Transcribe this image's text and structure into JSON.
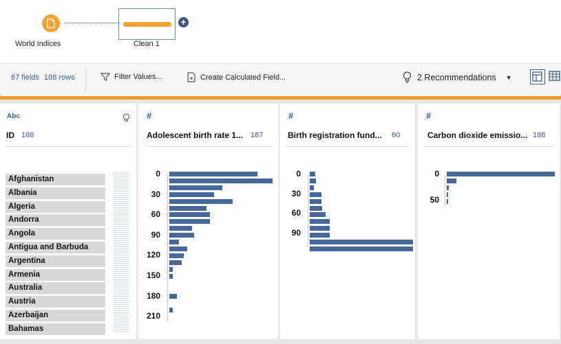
{
  "flow": {
    "input_node_label": "World Indices",
    "clean_node_label": "Clean 1",
    "add_step_symbol": "+"
  },
  "toolbar": {
    "fields_label": "67 fields",
    "rows_label": "188 rows",
    "filter_label": "Filter Values...",
    "calc_label": "Create Calculated Field...",
    "recommendations_label": "2 Recommendations",
    "caret": "▼"
  },
  "colors": {
    "accent": "#f0a334",
    "bar": "#45679a",
    "link": "#3e5b85"
  },
  "fields": {
    "id": {
      "type": "Abc",
      "name": "ID",
      "count": "188",
      "values": [
        "Afghanistan",
        "Albania",
        "Algeria",
        "Andorra",
        "Angola",
        "Antigua and Barbuda",
        "Argentina",
        "Armenia",
        "Australia",
        "Austria",
        "Azerbaijan",
        "Bahamas"
      ]
    },
    "adolescent": {
      "type": "#",
      "name": "Adolescent birth rate 1...",
      "count": "187",
      "ticks": [
        "0",
        "30",
        "60",
        "90",
        "120",
        "150",
        "180",
        "210"
      ],
      "bins": [
        0.85,
        1.0,
        0.51,
        0.43,
        0.61,
        0.36,
        0.39,
        0.39,
        0.22,
        0.24,
        0.09,
        0.17,
        0.14,
        0.12,
        0.03,
        0.03,
        0,
        0,
        0.07,
        0,
        0.03
      ]
    },
    "birth_reg": {
      "type": "#",
      "name": "Birth registration fund...",
      "count": "60",
      "ticks": [
        "0",
        "30",
        "60",
        "90"
      ],
      "bins": [
        0.05,
        0.06,
        0.04,
        0.11,
        0.11,
        0.12,
        0.15,
        0.19,
        0.19,
        0.19,
        1.0,
        1.0
      ]
    },
    "carbon": {
      "type": "#",
      "name": "Carbon dioxide emissio...",
      "count": "188",
      "ticks": [
        "0",
        "50"
      ],
      "bins": [
        1.0,
        0.09,
        0.02,
        0.01,
        0.01
      ]
    }
  }
}
